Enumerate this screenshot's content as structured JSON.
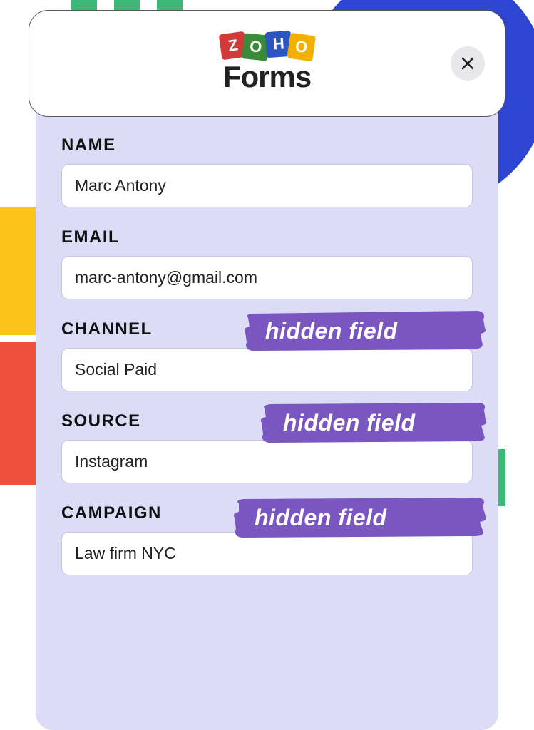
{
  "logo": {
    "letters": [
      "Z",
      "O",
      "H",
      "O"
    ],
    "word": "Forms"
  },
  "fields": [
    {
      "label": "NAME",
      "value": "Marc Antony",
      "hidden": false
    },
    {
      "label": "EMAIL",
      "value": "marc-antony@gmail.com",
      "hidden": false
    },
    {
      "label": "CHANNEL",
      "value": "Social Paid",
      "hidden": true
    },
    {
      "label": "SOURCE",
      "value": "Instagram",
      "hidden": true
    },
    {
      "label": "CAMPAIGN",
      "value": "Law firm NYC",
      "hidden": true
    }
  ],
  "annotation": {
    "hidden_field_text": "hidden field"
  },
  "colors": {
    "panel_bg": "#dcdcf6",
    "brush": "#7a56c0"
  }
}
